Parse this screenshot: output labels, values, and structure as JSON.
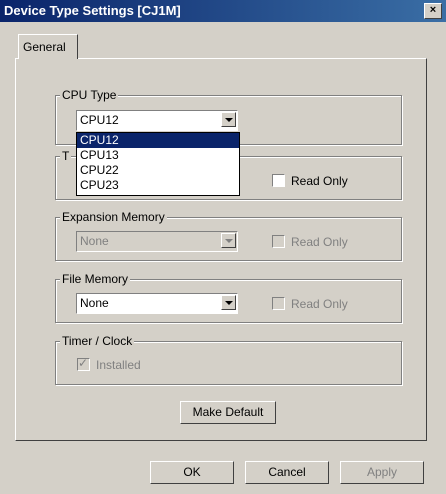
{
  "window": {
    "title": "Device Type Settings [CJ1M]",
    "close_glyph": "×"
  },
  "tabs": [
    {
      "label": "General"
    }
  ],
  "cpu_type": {
    "label": "CPU Type",
    "value": "CPU12",
    "options": [
      "CPU12",
      "CPU13",
      "CPU22",
      "CPU23"
    ]
  },
  "timer_group": {
    "label_partial": "T",
    "read_only_label": "Read Only"
  },
  "expansion_memory": {
    "label": "Expansion Memory",
    "value": "None",
    "read_only_label": "Read Only"
  },
  "file_memory": {
    "label": "File Memory",
    "value": "None",
    "read_only_label": "Read Only"
  },
  "timer_clock": {
    "label": "Timer / Clock",
    "installed_label": "Installed",
    "installed_checked": true
  },
  "buttons": {
    "make_default": "Make Default",
    "ok": "OK",
    "cancel": "Cancel",
    "apply": "Apply"
  }
}
